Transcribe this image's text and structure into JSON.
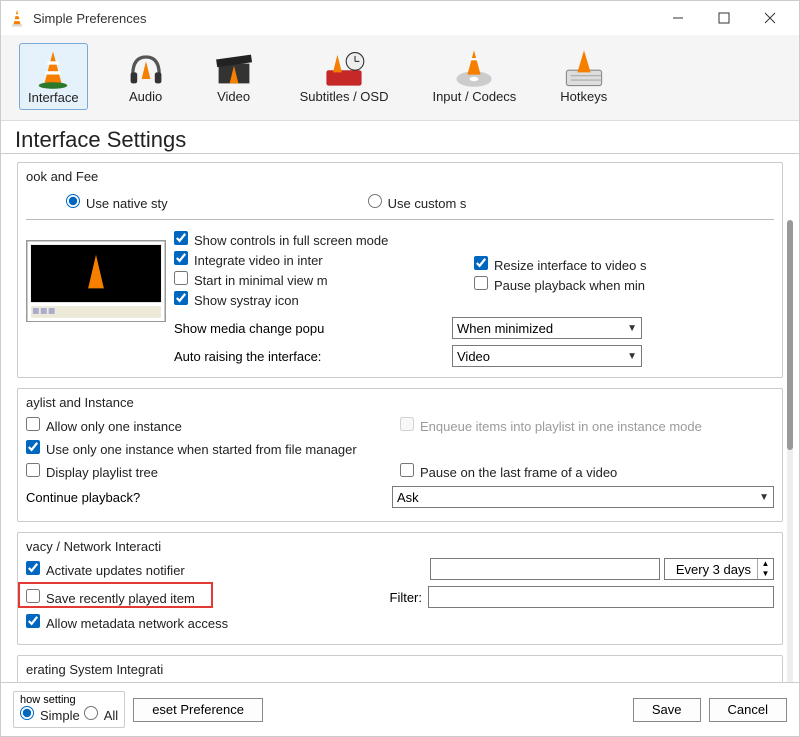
{
  "window": {
    "title": "Simple Preferences"
  },
  "tabs": [
    {
      "label": "Interface"
    },
    {
      "label": "Audio"
    },
    {
      "label": "Video"
    },
    {
      "label": "Subtitles / OSD"
    },
    {
      "label": "Input / Codecs"
    },
    {
      "label": "Hotkeys"
    }
  ],
  "heading": "Interface Settings",
  "look": {
    "group_title": "ook and Fee",
    "native": "Use native sty",
    "custom": "Use custom s",
    "show_controls": "Show controls in full screen mode",
    "integrate": "Integrate video in inter",
    "start_minimal": "Start in minimal view m",
    "systray": "Show systray icon",
    "resize": "Resize interface to video s",
    "pause_min": "Pause playback when min",
    "media_change_label": "Show media change popu",
    "media_change_value": "When minimized",
    "auto_raise_label": "Auto raising the interface:",
    "auto_raise_value": "Video"
  },
  "playlist": {
    "group_title": "aylist and Instance",
    "one_instance": "Allow only one instance",
    "enqueue": "Enqueue items into playlist in one instance mode",
    "one_from_fm": "Use only one instance when started from file manager",
    "display_tree": "Display playlist tree",
    "pause_last": "Pause on the last frame of a video",
    "continue_label": "Continue playback?",
    "continue_value": "Ask"
  },
  "privacy": {
    "group_title": "vacy / Network Interacti",
    "updates": "Activate updates notifier",
    "updates_value": "Every 3 days",
    "save_recent": "Save recently played item",
    "filter_label": "Filter:",
    "metadata": "Allow metadata network access"
  },
  "os": {
    "group_title": "erating System Integrati"
  },
  "bottom": {
    "show_label": "how setting",
    "simple": "Simple",
    "all": "All",
    "reset": "eset Preference",
    "save": "Save",
    "cancel": "Cancel"
  }
}
